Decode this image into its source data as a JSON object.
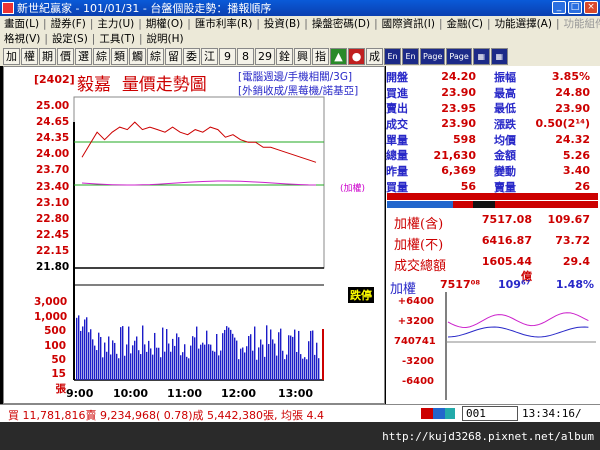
{
  "window": {
    "title": "新世紀贏家 - 101/01/31 - 台盤個股走勢：播報順序",
    "buttons": [
      "_",
      "□",
      "×"
    ]
  },
  "menu": {
    "row1": [
      "畫面(L)",
      "證券(F)",
      "主力(U)",
      "期權(O)",
      "匯市利率(R)",
      "投資(B)",
      "操盤密碼(D)",
      "國際資訊(I)",
      "金融(C)",
      "功能選擇(A)",
      "功能組件(K)"
    ],
    "row2": [
      "格視(V)",
      "設定(S)",
      "工具(T)",
      "說明(H)"
    ]
  },
  "toolbar": {
    "buttons": [
      "加",
      "權",
      "期",
      "價",
      "選",
      "綜",
      "類",
      "觸",
      "綜",
      "留",
      "委",
      "江",
      "9",
      "8",
      "29",
      "銓",
      "興",
      "指",
      "▲",
      "●",
      "成",
      "En",
      "En",
      "Page",
      "Page",
      "▦",
      "▦"
    ]
  },
  "stock": {
    "code": "[2402]",
    "name": "毅嘉",
    "view_title": "量價走勢圖",
    "link1": "[電腦週邊/手機相關/3G]",
    "link2": "[外銷收成/黑莓機/諾基亞]",
    "tag_reference": "(加權)",
    "tag_limit": "跌停"
  },
  "quote": {
    "rows": [
      {
        "l": "開盤",
        "v": "24.20",
        "l2": "振幅",
        "v2": "3.85%"
      },
      {
        "l": "買進",
        "v": "23.90",
        "l2": "最高",
        "v2": "24.80"
      },
      {
        "l": "賣出",
        "v": "23.95",
        "l2": "最低",
        "v2": "23.90"
      },
      {
        "l": "成交",
        "v": "23.90",
        "l2": "漲跌",
        "v2": "0.50(2¹⁴)"
      },
      {
        "l": "單量",
        "v": "598",
        "l2": "均價",
        "v2": "24.32"
      },
      {
        "l": "總量",
        "v": "21,630",
        "l2": "金額",
        "v2": "5.26"
      },
      {
        "l": "昨量",
        "v": "6,369",
        "l2": "變動",
        "v2": "3.40"
      },
      {
        "l": "買量",
        "v": "56",
        "l2": "賣量",
        "v2": "26"
      }
    ]
  },
  "index": {
    "rows": [
      {
        "l": "加權(含)",
        "v": "7517.08",
        "v2": "109.67"
      },
      {
        "l": "加權(不)",
        "v": "6416.87",
        "v2": "73.72"
      },
      {
        "l": "成交總額",
        "v": "1605.44億",
        "v2": "29.4"
      }
    ],
    "mini_label": "加權",
    "mini_value": "7517⁰⁸",
    "mini_change": "109⁶⁷",
    "mini_pct": "1.48%",
    "mini_y": [
      "+6400",
      "+3200",
      "740741",
      "-3200",
      "-6400"
    ]
  },
  "bottom": {
    "status": "買 11,781,816賣 9,234,968( 0.78)成 5,442,380張, 均張 4.4",
    "stock_no": "001",
    "time": "13:34:16/",
    "url": "http://kujd3268.pixnet.net/album"
  },
  "colors": {
    "red": "#cc0000",
    "blue": "#2828c8",
    "green": "#22aa22",
    "magenta": "#cc22cc"
  },
  "chart_data": {
    "type": "line",
    "title": "量價走勢圖",
    "x_ticks": [
      "9:00",
      "10:00",
      "11:00",
      "12:00",
      "13:00"
    ],
    "price_ticks": [
      "25.00",
      "24.65",
      "24.35",
      "24.00",
      "23.70",
      "23.40",
      "23.10",
      "22.80",
      "22.45",
      "22.15",
      "21.80"
    ],
    "volume_ticks": [
      "3,000",
      "1,000",
      "500",
      "100",
      "50",
      "15",
      "張"
    ],
    "price_ylim": [
      21.8,
      25.0
    ],
    "reference_price": 24.35,
    "price_series_hint": {
      "open": 24.2,
      "high": 24.8,
      "low": 23.9,
      "close": 23.9
    }
  }
}
